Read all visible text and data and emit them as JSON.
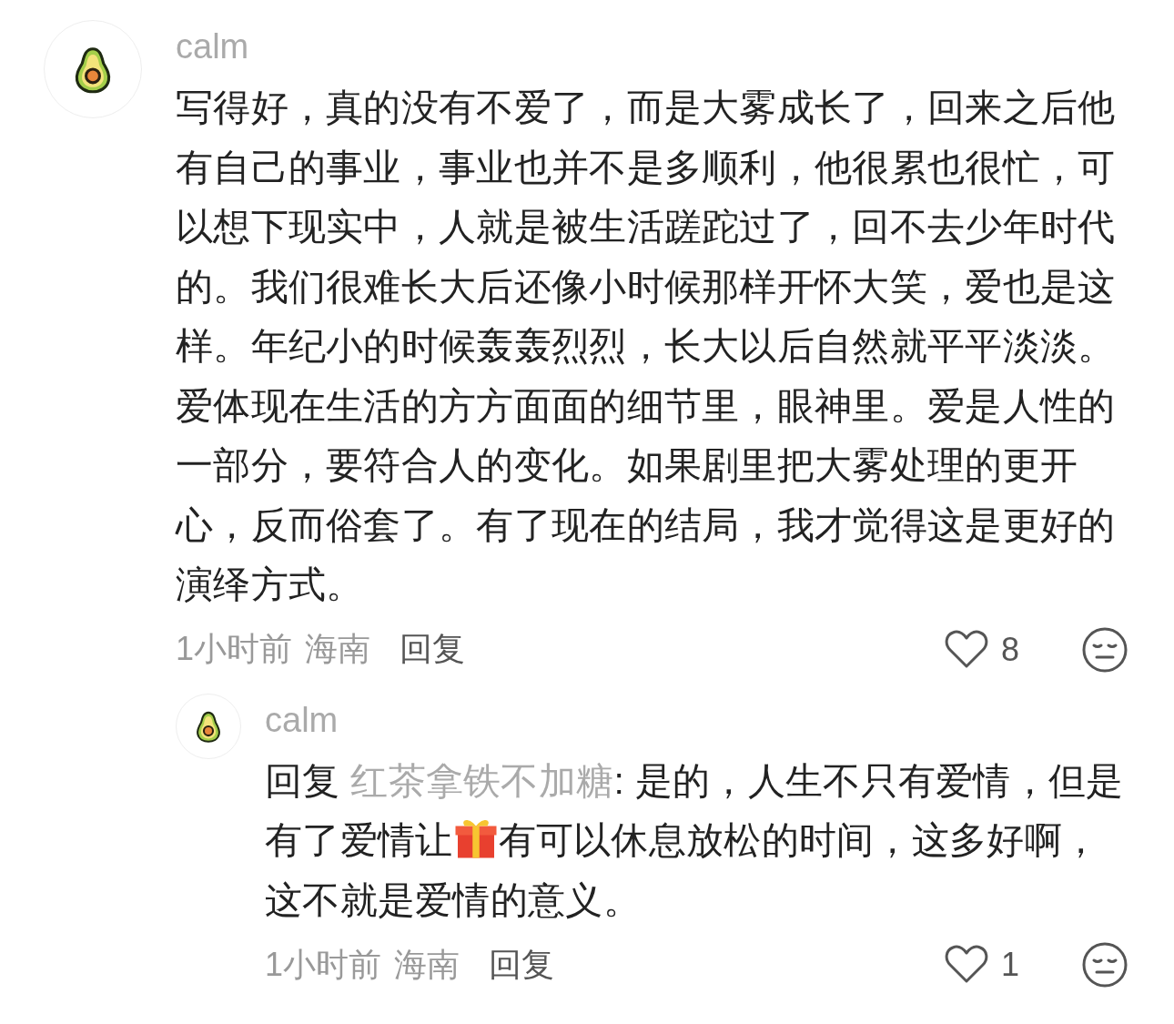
{
  "comment": {
    "author": "calm",
    "text": "写得好，真的没有不爱了，而是大雾成长了，回来之后他有自己的事业，事业也并不是多顺利，他很累也很忙，可以想下现实中，人就是被生活蹉跎过了，回不去少年时代的。我们很难长大后还像小时候那样开怀大笑，爱也是这样。年纪小的时候轰轰烈烈，长大以后自然就平平淡淡。爱体现在生活的方方面面的细节里，眼神里。爱是人性的一部分，要符合人的变化。如果剧里把大雾处理的更开心，反而俗套了。有了现在的结局，我才觉得这是更好的演绎方式。",
    "time": "1小时前",
    "location": "海南",
    "reply_label": "回复",
    "likes": "8",
    "replies": [
      {
        "author": "calm",
        "segments": [
          {
            "kind": "text",
            "text": "回复 "
          },
          {
            "kind": "mention",
            "text": "红茶拿铁不加糖"
          },
          {
            "kind": "text",
            "text": ": 是的，人生不只有爱情，但是有了爱情让"
          },
          {
            "kind": "gift"
          },
          {
            "kind": "text",
            "text": "有可以休息放松的时间，这多好啊，这不就是爱情的意义。"
          }
        ],
        "time": "1小时前",
        "location": "海南",
        "reply_label": "回复",
        "likes": "1"
      }
    ]
  }
}
